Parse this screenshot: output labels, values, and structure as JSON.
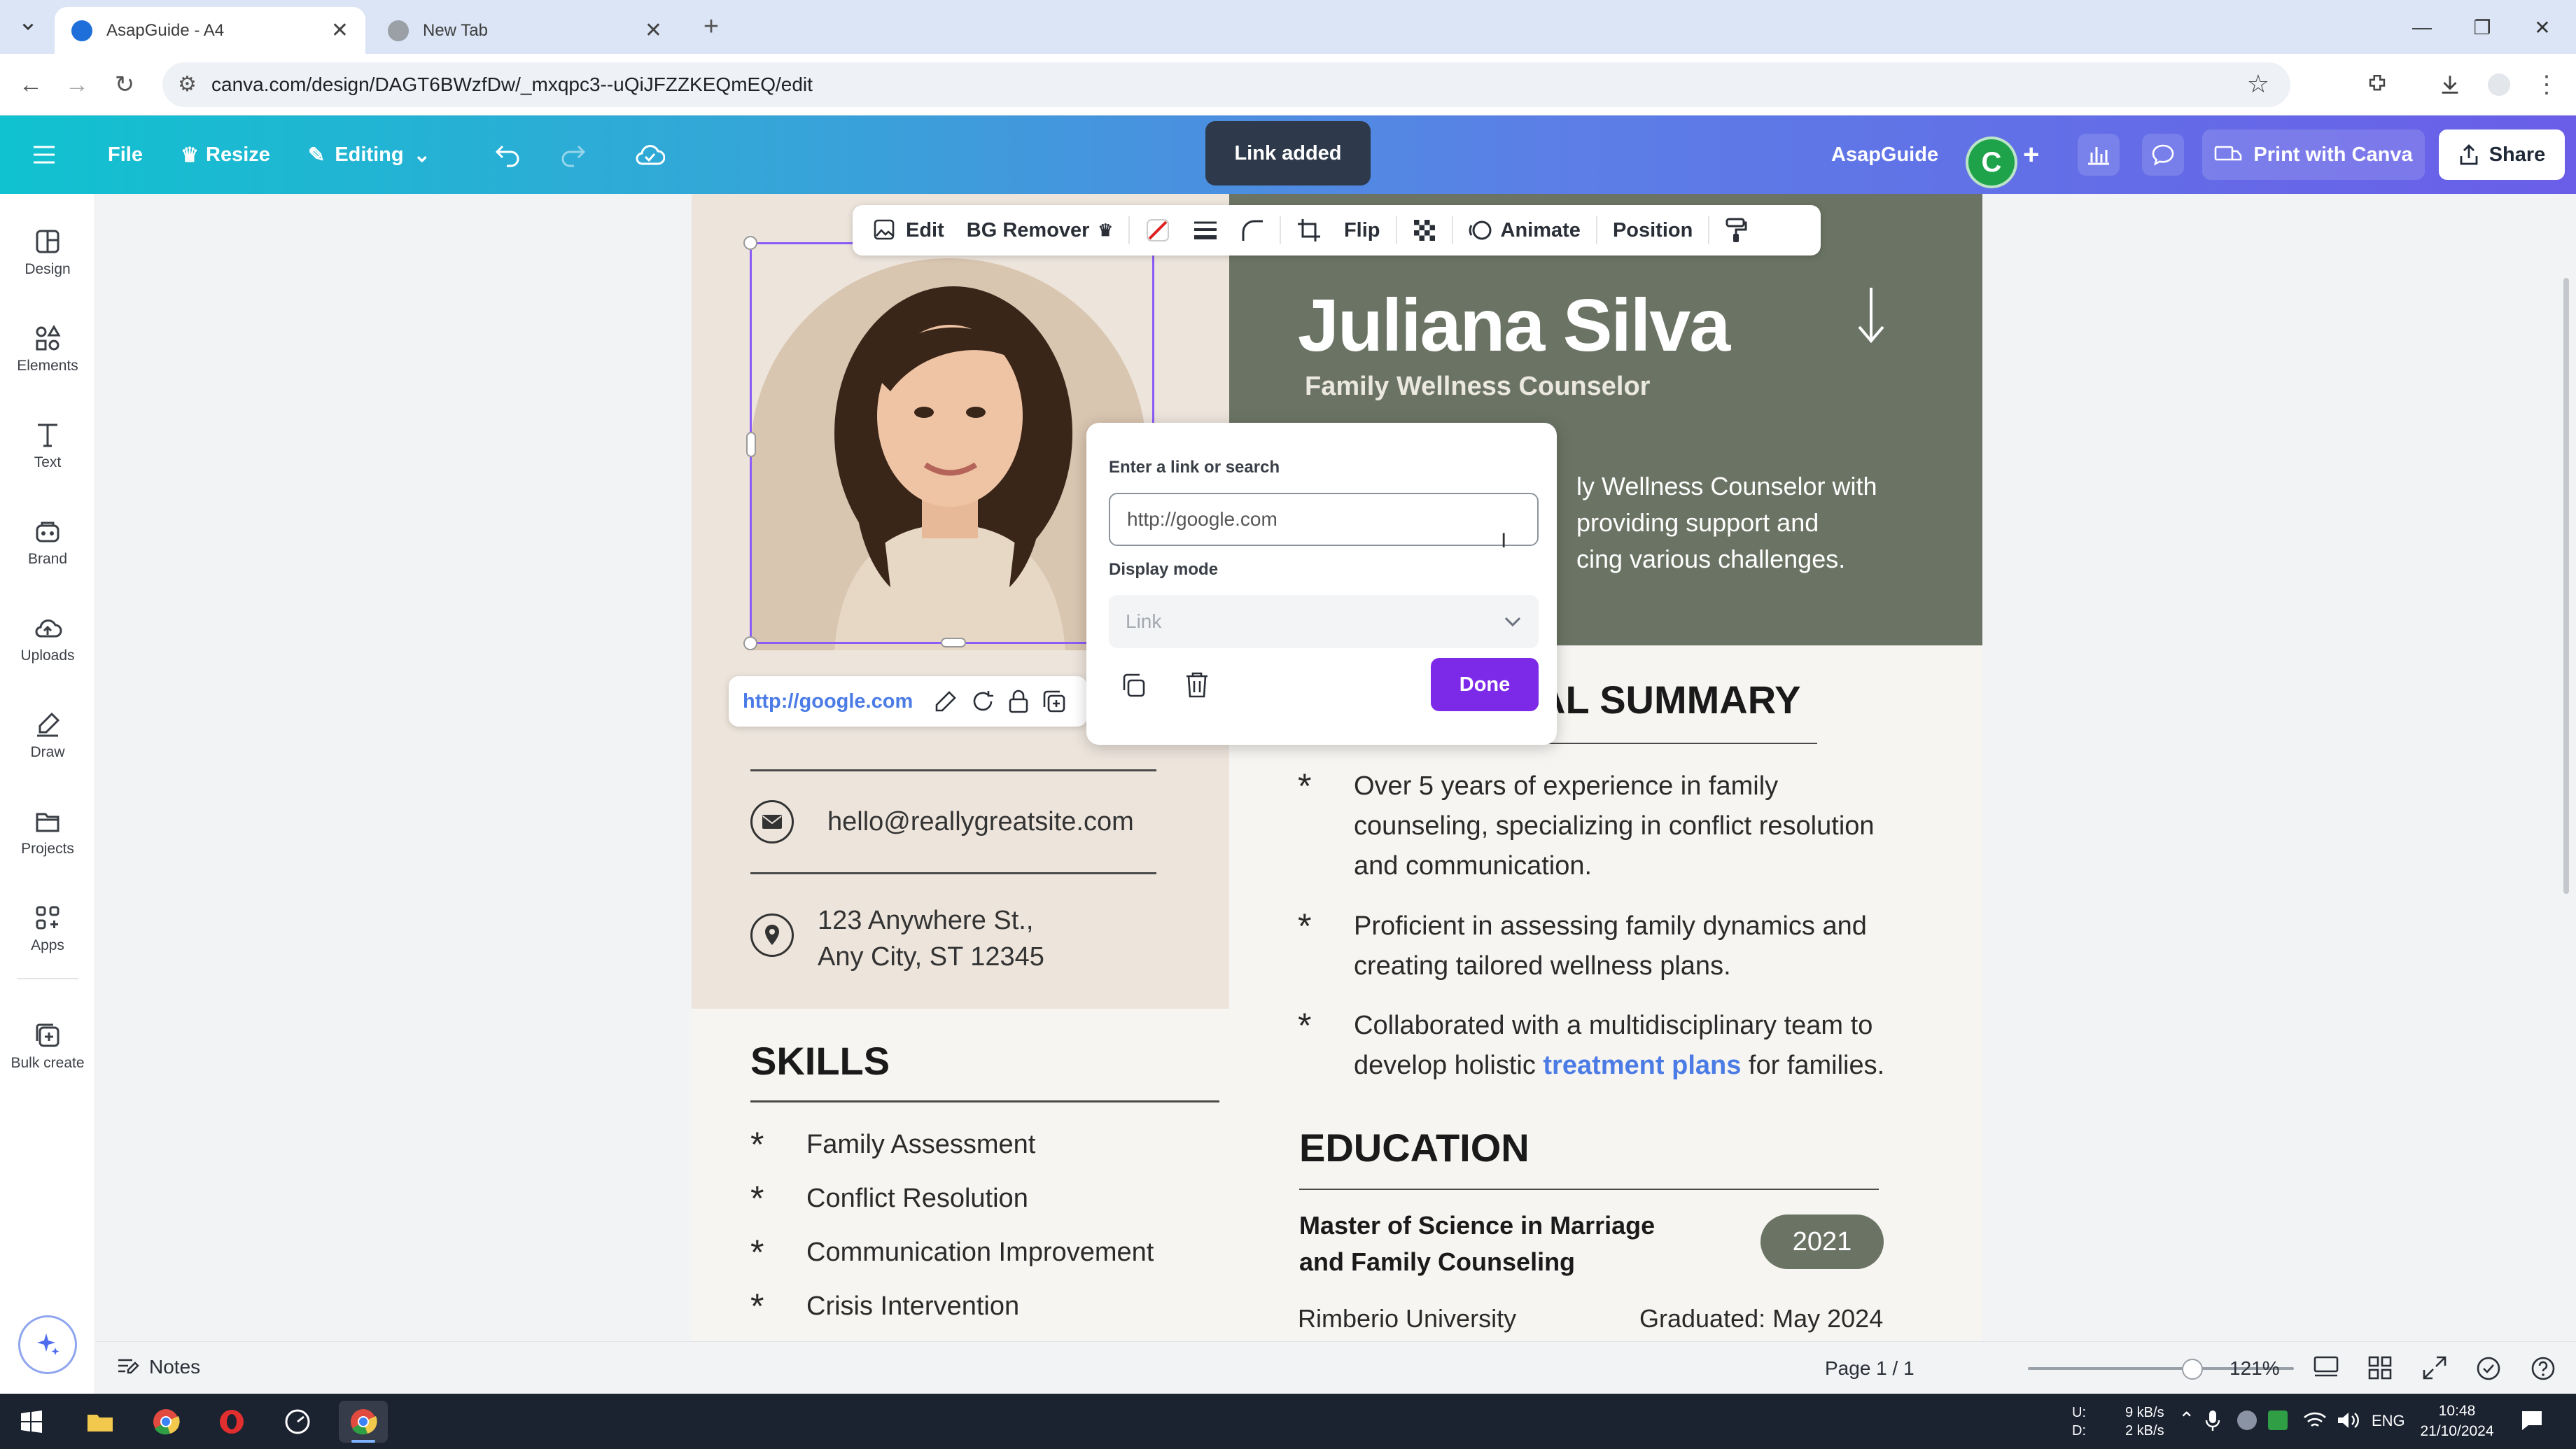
{
  "browser": {
    "tabs": [
      {
        "title": "AsapGuide - A4",
        "active": true
      },
      {
        "title": "New Tab",
        "active": false
      }
    ],
    "url": "canva.com/design/DAGT6BWzfDw/_mxqpc3--uQiJFZZKEQmEQ/edit"
  },
  "header": {
    "file_label": "File",
    "resize_label": "Resize",
    "editing_label": "Editing",
    "toast": "Link added",
    "team_name": "AsapGuide",
    "avatar_letter": "C",
    "print_label": "Print with Canva",
    "share_label": "Share"
  },
  "sidebar": {
    "items": [
      {
        "label": "Design",
        "icon": "layout-icon"
      },
      {
        "label": "Elements",
        "icon": "shapes-icon"
      },
      {
        "label": "Text",
        "icon": "text-icon"
      },
      {
        "label": "Brand",
        "icon": "brand-icon"
      },
      {
        "label": "Uploads",
        "icon": "cloud-upload-icon"
      },
      {
        "label": "Draw",
        "icon": "pen-icon"
      },
      {
        "label": "Projects",
        "icon": "folder-icon"
      },
      {
        "label": "Apps",
        "icon": "apps-icon"
      },
      {
        "label": "Bulk create",
        "icon": "bulk-icon"
      }
    ]
  },
  "element_toolbar": {
    "edit": "Edit",
    "bg_remover": "BG Remover",
    "flip": "Flip",
    "animate": "Animate",
    "position": "Position"
  },
  "link_chip": {
    "url": "http://google.com"
  },
  "link_popover": {
    "input_label": "Enter a link or search",
    "input_value": "http://google.com",
    "display_mode_label": "Display mode",
    "display_mode_value": "Link",
    "done_label": "Done"
  },
  "resume": {
    "name": "Juliana Silva",
    "title": "Family Wellness Counselor",
    "about_lines": [
      "ly Wellness Counselor with",
      "providing support and",
      "cing various challenges."
    ],
    "contact": {
      "email": "hello@reallygreatsite.com",
      "address_line1": "123 Anywhere St.,",
      "address_line2": "Any City, ST 12345"
    },
    "skills_heading": "SKILLS",
    "skills": [
      "Family Assessment",
      "Conflict Resolution",
      "Communication Improvement",
      "Crisis Intervention"
    ],
    "summary_heading": "AL SUMMARY",
    "summary_items": [
      {
        "lines": [
          "Over 5 years of experience in family",
          "counseling, specializing in conflict resolution",
          "and communication."
        ]
      },
      {
        "lines": [
          "Proficient in assessing family dynamics and",
          "creating tailored wellness plans."
        ]
      },
      {
        "line1": "Collaborated with a multidisciplinary team to",
        "line2_pre": "develop holistic ",
        "line2_link": "treatment plans",
        "line2_post": " for families."
      }
    ],
    "education_heading": "EDUCATION",
    "degree": "Master of Science in Marriage and Family Counseling",
    "year": "2021",
    "university": "Rimberio University",
    "graduated": "Graduated: May 2024"
  },
  "bottom_bar": {
    "notes_label": "Notes",
    "page_indicator": "Page 1 / 1",
    "zoom": "121%"
  },
  "taskbar": {
    "net_up": "9 kB/s",
    "net_down": "2 kB/s",
    "net_u": "U:",
    "net_d": "D:",
    "lang": "ENG",
    "time": "10:48",
    "date": "21/10/2024"
  },
  "colors": {
    "header_gradient_start": "#10c2cf",
    "header_gradient_end": "#6a5ee8",
    "done_purple": "#7d2ae8",
    "resume_green": "#6b7464",
    "link_blue": "#4b7be5"
  }
}
